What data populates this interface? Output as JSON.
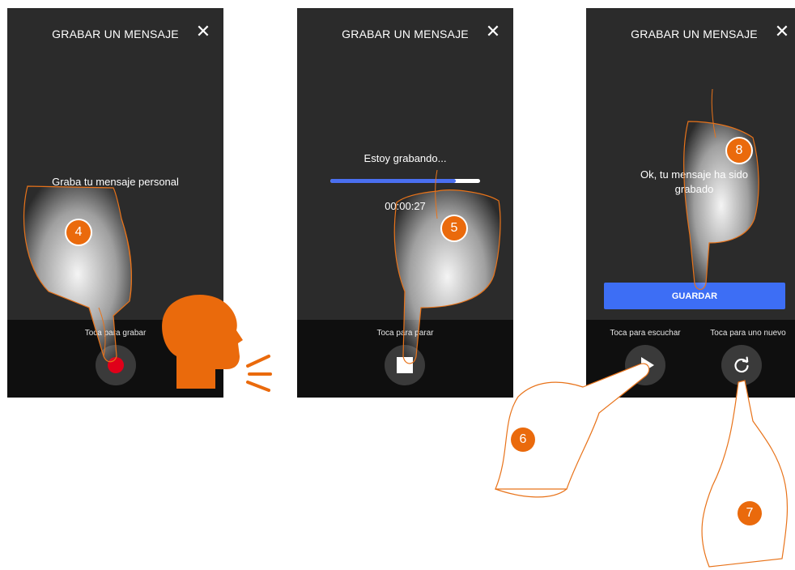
{
  "screens": [
    {
      "title": "GRABAR UN MENSAJE",
      "close_icon": "close-icon",
      "message": "Graba tu mensaje personal",
      "hint": "Toca para grabar",
      "button_icon": "record-icon"
    },
    {
      "title": "GRABAR UN MENSAJE",
      "close_icon": "close-icon",
      "message": "Estoy grabando...",
      "progress": 0.84,
      "timer": "00:00:27",
      "hint": "Toca para parar",
      "button_icon": "stop-icon"
    },
    {
      "title": "GRABAR UN MENSAJE",
      "close_icon": "close-icon",
      "message": "Ok, tu mensaje ha sido grabado",
      "save_label": "GUARDAR",
      "hint_listen": "Toca para escuchar",
      "hint_new": "Toca para uno nuevo",
      "play_icon": "play-icon",
      "refresh_icon": "refresh-icon"
    }
  ],
  "steps": [
    "4",
    "5",
    "6",
    "7",
    "8"
  ],
  "colors": {
    "screen_bg": "#2b2b2b",
    "bottom_bar": "#0f0f0f",
    "record_red": "#e00019",
    "accent_blue": "#3d6ef5",
    "step_orange": "#ea6a0c"
  }
}
